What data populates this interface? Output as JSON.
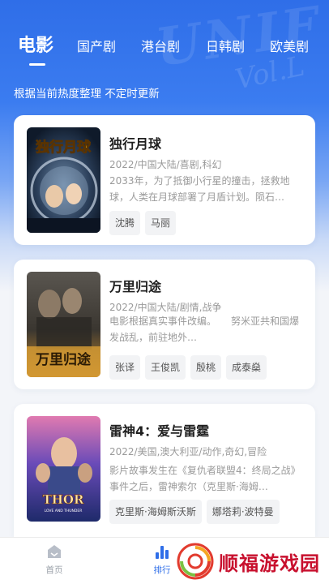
{
  "tabs": [
    {
      "label": "电影",
      "active": true
    },
    {
      "label": "国产剧",
      "active": false
    },
    {
      "label": "港台剧",
      "active": false
    },
    {
      "label": "日韩剧",
      "active": false
    },
    {
      "label": "欧美剧",
      "active": false
    }
  ],
  "subtitle": "根据当前热度整理 不定时更新",
  "movies": [
    {
      "title": "独行月球",
      "meta": "2022/中国大陆/喜剧,科幻",
      "desc": "2033年，为了抵御小行星的撞击，拯救地球，人类在月球部署了月盾计划。陨石…",
      "actors": [
        "沈腾",
        "马丽"
      ],
      "poster_text": "独行月球"
    },
    {
      "title": "万里归途",
      "meta": "2022/中国大陆/剧情,战争",
      "desc": "电影根据真实事件改编。　　努米亚共和国爆发战乱，前驻地外…",
      "actors": [
        "张译",
        "王俊凯",
        "殷桃",
        "成泰燊"
      ],
      "poster_text": "万里归途"
    },
    {
      "title": "雷神4：爱与雷霆",
      "meta": "2022/美国,澳大利亚/动作,奇幻,冒险",
      "desc": "影片故事发生在《复仇者联盟4：终局之战》事件之后，雷神索尔（克里斯·海姆…",
      "actors": [
        "克里斯·海姆斯沃斯",
        "娜塔莉·波特曼"
      ],
      "poster_text": "THOR",
      "poster_subtext": "LOVE AND THUNDER"
    }
  ],
  "bottom_nav": [
    {
      "label": "首页",
      "icon": "home-icon",
      "active": false
    },
    {
      "label": "排行",
      "icon": "ranking-icon",
      "active": true
    }
  ],
  "watermark": {
    "text": "顺福游戏园",
    "icon": "fu-logo-icon"
  },
  "colors": {
    "accent": "#2f6ee8",
    "nav_active": "#2f6ee8",
    "nav_inactive": "#9aa0a8",
    "watermark": "#c8102e"
  }
}
